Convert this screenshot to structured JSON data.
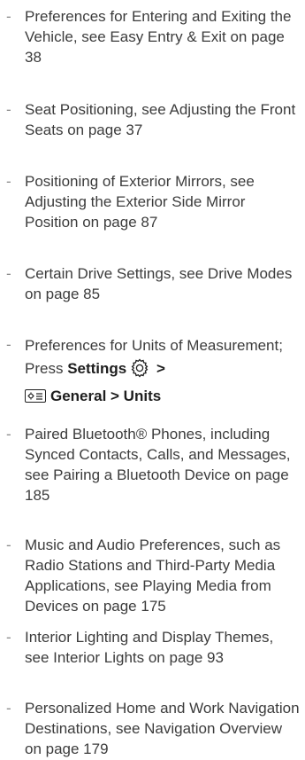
{
  "items": [
    {
      "text": "Preferences for Entering and Exiting the Vehicle, see Easy Entry & Exit on page 38"
    },
    {
      "text": "Seat Positioning, see Adjusting the Front Seats on page 37"
    },
    {
      "text": "Positioning of Exterior Mirrors, see Adjusting the Exterior Side Mirror Position on page 87"
    },
    {
      "text": "Certain Drive Settings, see Drive Modes on page 85"
    },
    {
      "text_a": "Preferences for Units of Measurement; Press ",
      "bold_settings": "Settings",
      "sep1": " >",
      "bold_general": "General > Units",
      "settings_icon": "gear-icon",
      "general_icon": "general-settings-icon"
    },
    {
      "text": "Paired Bluetooth® Phones, including Synced Contacts, Calls, and Messages, see Pairing a Bluetooth Device on page 185"
    },
    {
      "text": "Music and Audio Preferences, such as Radio Stations and Third-Party Media Applications, see Playing Media from Devices on page 175"
    },
    {
      "text": "Interior Lighting and Display Themes, see Interior Lights on page 93"
    },
    {
      "text": "Personalized Home and Work Navigation Destinations, see Navigation Overview on page 179"
    }
  ],
  "bullet": "-"
}
